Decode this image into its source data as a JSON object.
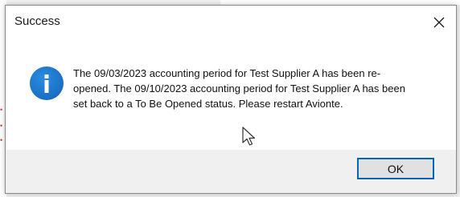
{
  "dialog": {
    "title": "Success",
    "message": "The 09/03/2023 accounting period for Test Supplier A has been re-opened. The 09/10/2023 accounting period for Test Supplier A has been set back to a To Be Opened status. Please restart Avionte.",
    "ok_label": "OK",
    "icon": "info-icon",
    "close_icon": "close-icon"
  },
  "colors": {
    "info_icon": "#1a6fc4",
    "ok_border": "#0067c0",
    "footer_bg": "#f0f0f0"
  }
}
